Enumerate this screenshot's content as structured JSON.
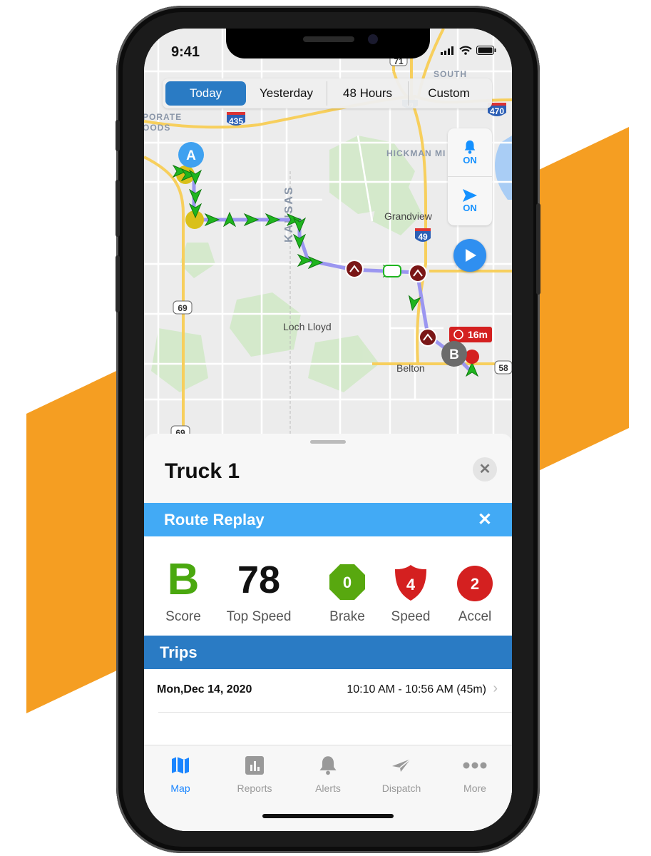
{
  "colors": {
    "accent": "#2a7bc4",
    "route_replay_bar": "#42aaf5",
    "score_green": "#4aa80f",
    "event_red": "#d42020",
    "orange_stripe": "#f59e22",
    "route_line": "#9b96f0"
  },
  "status_bar": {
    "time": "9:41"
  },
  "range_selector": {
    "options": [
      "Today",
      "Yesterday",
      "48 Hours",
      "Custom"
    ],
    "selected": "Today"
  },
  "map": {
    "labels": {
      "south": "SOUTH",
      "porate": "PORATE",
      "oods": "OODS",
      "hickman": "HICKMAN MI",
      "kansas": "KANSAS",
      "grandview": "Grandview",
      "loch_lloyd": "Loch Lloyd",
      "belton": "Belton"
    },
    "shields": {
      "i435": "435",
      "i470": "470",
      "i49": "49",
      "i49b": "49",
      "us69": "69",
      "us69b": "69",
      "us71": "71",
      "r58": "58"
    },
    "start_marker": "A",
    "end_marker": "B",
    "stop_badge": "16m"
  },
  "side_controls": {
    "alerts": {
      "icon": "bell-icon",
      "state": "ON"
    },
    "follow": {
      "icon": "location-arrow-icon",
      "state": "ON"
    }
  },
  "play_button": {
    "icon": "play-icon"
  },
  "sheet": {
    "title": "Truck 1",
    "route_replay": {
      "title": "Route Replay",
      "close": "✕"
    },
    "stats": {
      "score": {
        "value": "B",
        "label": "Score"
      },
      "top_speed": {
        "value": "78",
        "label": "Top Speed"
      },
      "brake": {
        "value": "0",
        "label": "Brake"
      },
      "speed": {
        "value": "4",
        "label": "Speed"
      },
      "accel": {
        "value": "2",
        "label": "Accel"
      }
    },
    "trips": {
      "title": "Trips",
      "items": [
        {
          "date": "Mon,Dec 14, 2020",
          "time": "10:10 AM - 10:56 AM (45m)"
        }
      ]
    }
  },
  "tabbar": {
    "items": [
      {
        "label": "Map",
        "icon": "map-icon",
        "active": true
      },
      {
        "label": "Reports",
        "icon": "bar-chart-icon",
        "active": false
      },
      {
        "label": "Alerts",
        "icon": "bell-icon",
        "active": false
      },
      {
        "label": "Dispatch",
        "icon": "paper-plane-icon",
        "active": false
      },
      {
        "label": "More",
        "icon": "more-dots-icon",
        "active": false
      }
    ]
  }
}
